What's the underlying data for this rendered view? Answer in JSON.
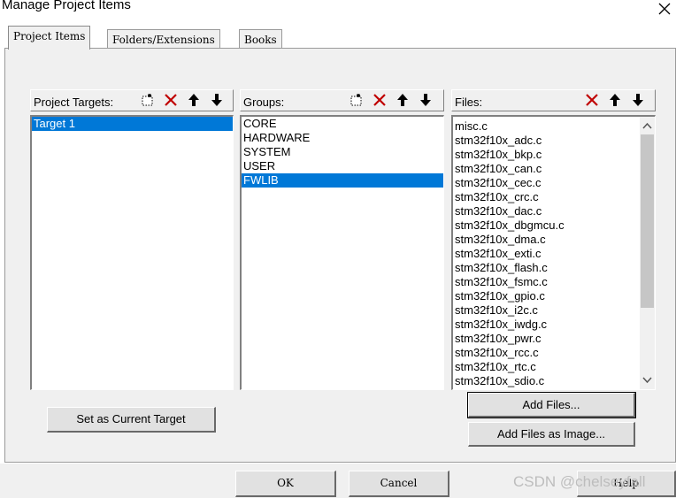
{
  "window": {
    "title": "Manage Project Items"
  },
  "tabs": [
    {
      "label": "Project Items",
      "active": true
    },
    {
      "label": "Folders/Extensions",
      "active": false
    },
    {
      "label": "Books",
      "active": false
    }
  ],
  "targets": {
    "label": "Project Targets:",
    "items": [
      "Target 1"
    ],
    "selected_index": 0,
    "toolbar_icons": [
      "new-icon",
      "delete-icon",
      "move-up-icon",
      "move-down-icon"
    ]
  },
  "groups": {
    "label": "Groups:",
    "items": [
      "CORE",
      "HARDWARE",
      "SYSTEM",
      "USER",
      "FWLIB"
    ],
    "selected_index": 4,
    "toolbar_icons": [
      "new-icon",
      "delete-icon",
      "move-up-icon",
      "move-down-icon"
    ]
  },
  "files": {
    "label": "Files:",
    "items": [
      "misc.c",
      "stm32f10x_adc.c",
      "stm32f10x_bkp.c",
      "stm32f10x_can.c",
      "stm32f10x_cec.c",
      "stm32f10x_crc.c",
      "stm32f10x_dac.c",
      "stm32f10x_dbgmcu.c",
      "stm32f10x_dma.c",
      "stm32f10x_exti.c",
      "stm32f10x_flash.c",
      "stm32f10x_fsmc.c",
      "stm32f10x_gpio.c",
      "stm32f10x_i2c.c",
      "stm32f10x_iwdg.c",
      "stm32f10x_pwr.c",
      "stm32f10x_rcc.c",
      "stm32f10x_rtc.c",
      "stm32f10x_sdio.c"
    ],
    "toolbar_icons": [
      "delete-icon",
      "move-up-icon",
      "move-down-icon"
    ]
  },
  "buttons": {
    "set_current_target": "Set as Current Target",
    "add_files": "Add Files...",
    "add_files_as_image": "Add Files as Image...",
    "ok": "OK",
    "cancel": "Cancel",
    "help": "Help"
  },
  "watermark": "CSDN @chelseyfall",
  "colors": {
    "selection": "#0078d7",
    "delete_icon": "#c00000",
    "dialog_bg": "#f0f0f0"
  }
}
